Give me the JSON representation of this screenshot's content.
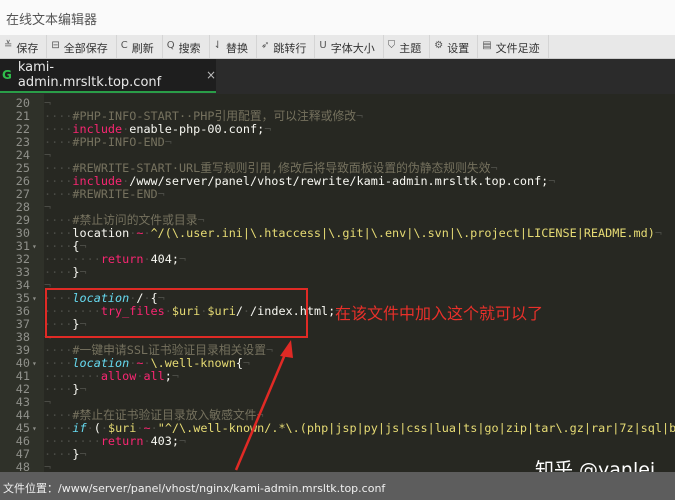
{
  "window": {
    "title": "在线文本编辑器"
  },
  "toolbar": [
    {
      "icon": "save-icon",
      "glyph": "≚",
      "label": "保存"
    },
    {
      "icon": "save-all-icon",
      "glyph": "⊟",
      "label": "全部保存"
    },
    {
      "icon": "refresh-icon",
      "glyph": "C",
      "label": "刷新"
    },
    {
      "icon": "search-icon",
      "glyph": "Q",
      "label": "搜索"
    },
    {
      "icon": "replace-icon",
      "glyph": "⇃",
      "label": "替换"
    },
    {
      "icon": "goto-line-icon",
      "glyph": "➶",
      "label": "跳转行"
    },
    {
      "icon": "font-size-icon",
      "glyph": "U",
      "label": "字体大小"
    },
    {
      "icon": "theme-icon",
      "glyph": "⛉",
      "label": "主题"
    },
    {
      "icon": "settings-icon",
      "glyph": "⚙",
      "label": "设置"
    },
    {
      "icon": "file-history-icon",
      "glyph": "▤",
      "label": "文件足迹"
    }
  ],
  "tab": {
    "icon_letter": "G",
    "name": "kami-admin.mrsltk.top.conf",
    "close": "×"
  },
  "lines": [
    {
      "n": "20",
      "t": [
        [
          "ws",
          "¬"
        ]
      ]
    },
    {
      "n": "21",
      "t": [
        [
          "ws",
          "····"
        ],
        [
          "cm",
          "#PHP-INFO-START··PHP引用配置，可以注释或修改"
        ],
        [
          "ws",
          "¬"
        ]
      ]
    },
    {
      "n": "22",
      "t": [
        [
          "ws",
          "····"
        ],
        [
          "kw",
          "include"
        ],
        [
          "ws",
          "·"
        ],
        [
          "tx",
          "enable-php-00.conf;"
        ],
        [
          "ws",
          "¬"
        ]
      ]
    },
    {
      "n": "23",
      "t": [
        [
          "ws",
          "····"
        ],
        [
          "cm",
          "#PHP-INFO-END"
        ],
        [
          "ws",
          "¬"
        ]
      ]
    },
    {
      "n": "24",
      "t": [
        [
          "ws",
          "¬"
        ]
      ]
    },
    {
      "n": "25",
      "t": [
        [
          "ws",
          "····"
        ],
        [
          "cm",
          "#REWRITE-START·URL重写规则引用,修改后将导致面板设置的伪静态规则失效"
        ],
        [
          "ws",
          "¬"
        ]
      ]
    },
    {
      "n": "26",
      "t": [
        [
          "ws",
          "····"
        ],
        [
          "kw",
          "include"
        ],
        [
          "ws",
          "·"
        ],
        [
          "tx",
          "/www/server/panel/vhost/rewrite/kami-admin.mrsltk.top.conf;"
        ],
        [
          "ws",
          "¬"
        ]
      ]
    },
    {
      "n": "27",
      "t": [
        [
          "ws",
          "····"
        ],
        [
          "cm",
          "#REWRITE-END"
        ],
        [
          "ws",
          "¬"
        ]
      ]
    },
    {
      "n": "28",
      "t": [
        [
          "ws",
          "¬"
        ]
      ]
    },
    {
      "n": "29",
      "t": [
        [
          "ws",
          "····"
        ],
        [
          "cm",
          "#禁止访问的文件或目录"
        ],
        [
          "ws",
          "¬"
        ]
      ]
    },
    {
      "n": "30",
      "t": [
        [
          "ws",
          "····"
        ],
        [
          "tx",
          "location"
        ],
        [
          "ws",
          "·"
        ],
        [
          "kw",
          "~"
        ],
        [
          "ws",
          "·"
        ],
        [
          "st",
          "^/(\\.user.ini|\\.htaccess|\\.git|\\.env|\\.svn|\\.project|LICENSE|README.md)"
        ],
        [
          "ws",
          "¬"
        ]
      ]
    },
    {
      "n": "31",
      "f": true,
      "t": [
        [
          "ws",
          "····"
        ],
        [
          "tx",
          "{"
        ],
        [
          "ws",
          "¬"
        ]
      ]
    },
    {
      "n": "32",
      "t": [
        [
          "ws",
          "········"
        ],
        [
          "kw",
          "return"
        ],
        [
          "ws",
          "·"
        ],
        [
          "tx",
          "404;"
        ],
        [
          "ws",
          "¬"
        ]
      ]
    },
    {
      "n": "33",
      "t": [
        [
          "ws",
          "····"
        ],
        [
          "tx",
          "}"
        ],
        [
          "ws",
          "¬"
        ]
      ]
    },
    {
      "n": "34",
      "t": [
        [
          "ws",
          "¬"
        ]
      ]
    },
    {
      "n": "35",
      "f": true,
      "t": [
        [
          "ws",
          "····"
        ],
        [
          "lc",
          "location"
        ],
        [
          "ws",
          "·"
        ],
        [
          "tx",
          "/"
        ],
        [
          "ws",
          "·"
        ],
        [
          "tx",
          "{"
        ],
        [
          "ws",
          "¬"
        ]
      ]
    },
    {
      "n": "36",
      "t": [
        [
          "ws",
          "········"
        ],
        [
          "kw",
          "try_files"
        ],
        [
          "ws",
          "·"
        ],
        [
          "vr",
          "$uri"
        ],
        [
          "ws",
          "·"
        ],
        [
          "vr",
          "$uri"
        ],
        [
          "tx",
          "/"
        ],
        [
          "ws",
          "·"
        ],
        [
          "tx",
          "/index.html;"
        ],
        [
          "ws",
          "¬"
        ]
      ]
    },
    {
      "n": "37",
      "t": [
        [
          "ws",
          "····"
        ],
        [
          "tx",
          "}"
        ],
        [
          "ws",
          "¬"
        ]
      ]
    },
    {
      "n": "38",
      "t": [
        [
          "ws",
          "¬"
        ]
      ]
    },
    {
      "n": "39",
      "t": [
        [
          "ws",
          "····"
        ],
        [
          "cm",
          "#一键申请SSL证书验证目录相关设置"
        ],
        [
          "ws",
          "¬"
        ]
      ]
    },
    {
      "n": "40",
      "f": true,
      "t": [
        [
          "ws",
          "····"
        ],
        [
          "lc",
          "location"
        ],
        [
          "ws",
          "·"
        ],
        [
          "kw",
          "~"
        ],
        [
          "ws",
          "·"
        ],
        [
          "st",
          "\\.well-known"
        ],
        [
          "tx",
          "{"
        ],
        [
          "ws",
          "¬"
        ]
      ]
    },
    {
      "n": "41",
      "t": [
        [
          "ws",
          "········"
        ],
        [
          "kw",
          "allow"
        ],
        [
          "ws",
          "·"
        ],
        [
          "kw",
          "all"
        ],
        [
          "tx",
          ";"
        ],
        [
          "ws",
          "¬"
        ]
      ]
    },
    {
      "n": "42",
      "t": [
        [
          "ws",
          "····"
        ],
        [
          "tx",
          "}"
        ],
        [
          "ws",
          "¬"
        ]
      ]
    },
    {
      "n": "43",
      "t": [
        [
          "ws",
          "¬"
        ]
      ]
    },
    {
      "n": "44",
      "t": [
        [
          "ws",
          "····"
        ],
        [
          "cm",
          "#禁止在证书验证目录放入敏感文件"
        ],
        [
          "ws",
          "¬"
        ]
      ]
    },
    {
      "n": "45",
      "f": true,
      "t": [
        [
          "ws",
          "····"
        ],
        [
          "lc",
          "if"
        ],
        [
          "ws",
          "·"
        ],
        [
          "tx",
          "("
        ],
        [
          "ws",
          "·"
        ],
        [
          "vr",
          "$uri"
        ],
        [
          "ws",
          "·"
        ],
        [
          "kw",
          "~"
        ],
        [
          "ws",
          "·"
        ],
        [
          "st",
          "\"^/\\.well-known/.*\\.(php|jsp|py|js|css|lua|ts|go|zip|tar\\.gz|rar|7z|sql|bak)$\""
        ],
        [
          "ws",
          "·"
        ],
        [
          "tx",
          ")"
        ],
        [
          "ws",
          "·"
        ],
        [
          "tx",
          "{"
        ],
        [
          "ws",
          "¬"
        ]
      ]
    },
    {
      "n": "46",
      "t": [
        [
          "ws",
          "········"
        ],
        [
          "kw",
          "return"
        ],
        [
          "ws",
          "·"
        ],
        [
          "tx",
          "403;"
        ],
        [
          "ws",
          "¬"
        ]
      ]
    },
    {
      "n": "47",
      "t": [
        [
          "ws",
          "····"
        ],
        [
          "tx",
          "}"
        ],
        [
          "ws",
          "¬"
        ]
      ]
    },
    {
      "n": "48",
      "t": [
        [
          "ws",
          "¬"
        ]
      ]
    }
  ],
  "annotation": "在该文件中加入这个就可以了",
  "watermark": "知乎 @yanlei",
  "status": {
    "path": "文件位置：/www/server/panel/vhost/nginx/kami-admin.mrsltk.top.conf"
  },
  "colors": {
    "annotation": "#e02a25",
    "tab_accent": "#2a9d47"
  }
}
